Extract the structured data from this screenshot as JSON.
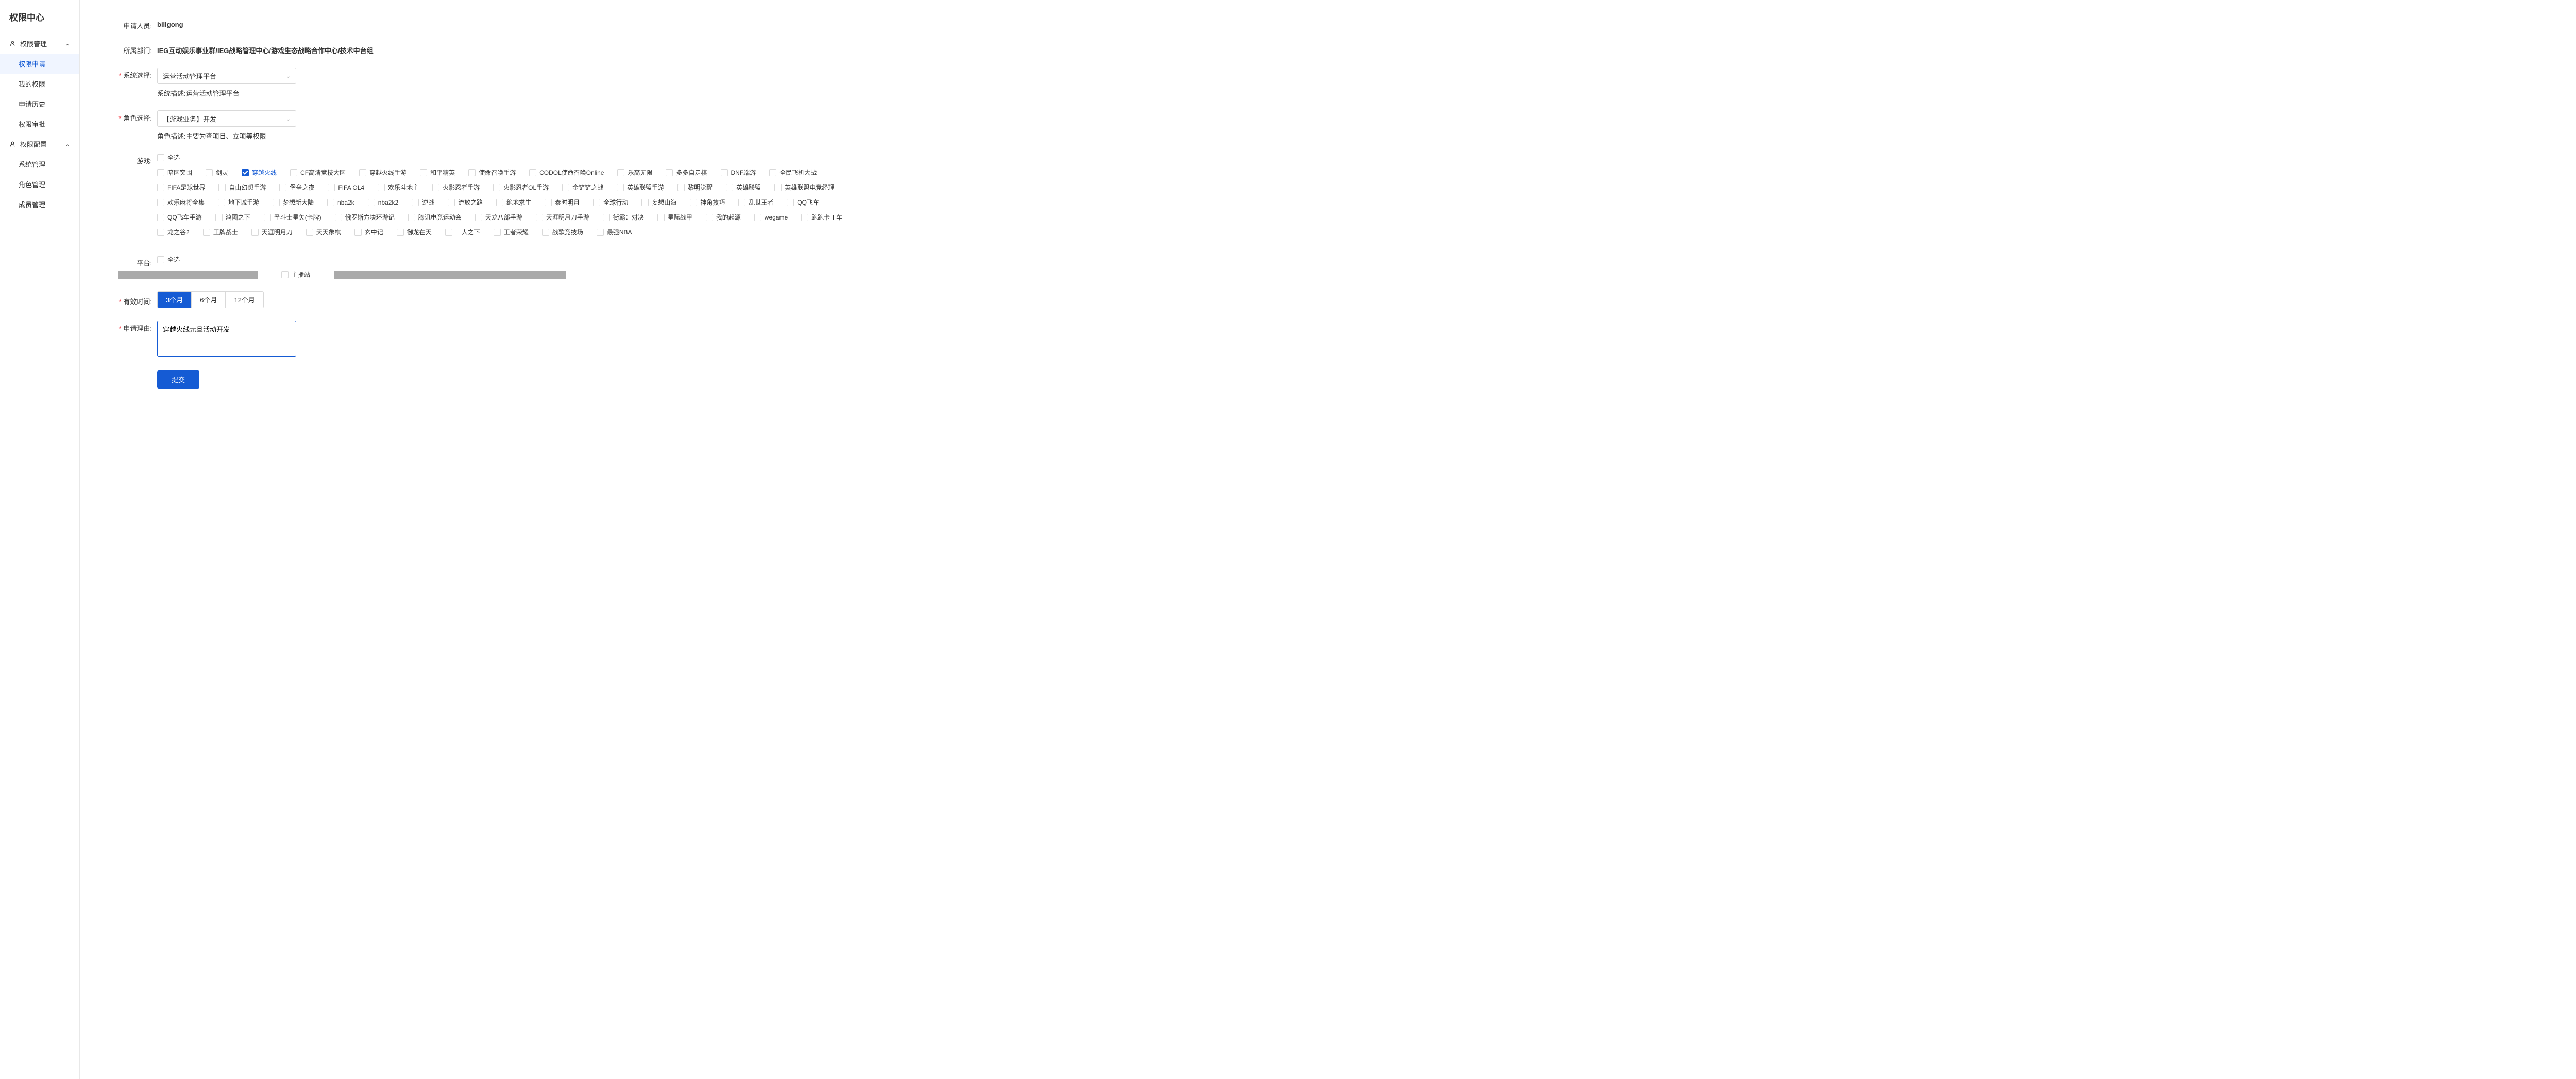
{
  "sidebar": {
    "title": "权限中心",
    "groups": [
      {
        "label": "权限管理",
        "expanded": true,
        "items": [
          {
            "label": "权限申请",
            "active": true
          },
          {
            "label": "我的权限",
            "active": false
          },
          {
            "label": "申请历史",
            "active": false
          },
          {
            "label": "权限审批",
            "active": false
          }
        ]
      },
      {
        "label": "权限配置",
        "expanded": true,
        "items": [
          {
            "label": "系统管理",
            "active": false
          },
          {
            "label": "角色管理",
            "active": false
          },
          {
            "label": "成员管理",
            "active": false
          }
        ]
      }
    ]
  },
  "form": {
    "applicant": {
      "label": "申请人员:",
      "value": "billgong"
    },
    "department": {
      "label": "所属部门:",
      "value": "IEG互动娱乐事业群/IEG战略管理中心/游戏生态战略合作中心/技术中台组"
    },
    "system": {
      "label": "系统选择:",
      "value": "运营活动管理平台",
      "desc": "系统描述:运营活动管理平台"
    },
    "role": {
      "label": "角色选择:",
      "value": "【游戏业务】开发",
      "desc": "角色描述:主要为查项目、立项等权限"
    },
    "games": {
      "label": "游戏:",
      "selectAll": "全选",
      "items": [
        {
          "label": "暗区突围",
          "checked": false
        },
        {
          "label": "剑灵",
          "checked": false
        },
        {
          "label": "穿越火线",
          "checked": true
        },
        {
          "label": "CF高清竞技大区",
          "checked": false
        },
        {
          "label": "穿越火线手游",
          "checked": false
        },
        {
          "label": "和平精英",
          "checked": false
        },
        {
          "label": "使命召唤手游",
          "checked": false
        },
        {
          "label": "CODOL使命召唤Online",
          "checked": false
        },
        {
          "label": "乐高无限",
          "checked": false
        },
        {
          "label": "多多自走棋",
          "checked": false
        },
        {
          "label": "DNF端游",
          "checked": false
        },
        {
          "label": "全民飞机大战",
          "checked": false
        },
        {
          "label": "FIFA足球世界",
          "checked": false
        },
        {
          "label": "自由幻想手游",
          "checked": false
        },
        {
          "label": "堡垒之夜",
          "checked": false
        },
        {
          "label": "FIFA OL4",
          "checked": false
        },
        {
          "label": "欢乐斗地主",
          "checked": false
        },
        {
          "label": "火影忍者手游",
          "checked": false
        },
        {
          "label": "火影忍者OL手游",
          "checked": false
        },
        {
          "label": "金铲铲之战",
          "checked": false
        },
        {
          "label": "英雄联盟手游",
          "checked": false
        },
        {
          "label": "黎明觉醒",
          "checked": false
        },
        {
          "label": "英雄联盟",
          "checked": false
        },
        {
          "label": "英雄联盟电竞经理",
          "checked": false
        },
        {
          "label": "欢乐麻将全集",
          "checked": false
        },
        {
          "label": "地下城手游",
          "checked": false
        },
        {
          "label": "梦想新大陆",
          "checked": false
        },
        {
          "label": "nba2k",
          "checked": false
        },
        {
          "label": "nba2k2",
          "checked": false
        },
        {
          "label": "逆战",
          "checked": false
        },
        {
          "label": "流放之路",
          "checked": false
        },
        {
          "label": "绝地求生",
          "checked": false
        },
        {
          "label": "秦时明月",
          "checked": false
        },
        {
          "label": "全球行动",
          "checked": false
        },
        {
          "label": "妄想山海",
          "checked": false
        },
        {
          "label": "神角技巧",
          "checked": false
        },
        {
          "label": "乱世王者",
          "checked": false
        },
        {
          "label": "QQ飞车",
          "checked": false
        },
        {
          "label": "QQ飞车手游",
          "checked": false
        },
        {
          "label": "鸿图之下",
          "checked": false
        },
        {
          "label": "圣斗士星矢(卡牌)",
          "checked": false
        },
        {
          "label": "俄罗斯方块环游记",
          "checked": false
        },
        {
          "label": "腾讯电竞运动会",
          "checked": false
        },
        {
          "label": "天龙八部手游",
          "checked": false
        },
        {
          "label": "天涯明月刀手游",
          "checked": false
        },
        {
          "label": "街霸：对决",
          "checked": false
        },
        {
          "label": "星际战甲",
          "checked": false
        },
        {
          "label": "我的起源",
          "checked": false
        },
        {
          "label": "wegame",
          "checked": false
        },
        {
          "label": "跑跑卡丁车",
          "checked": false
        },
        {
          "label": "龙之谷2",
          "checked": false
        },
        {
          "label": "王牌战士",
          "checked": false
        },
        {
          "label": "天涯明月刀",
          "checked": false
        },
        {
          "label": "天天象棋",
          "checked": false
        },
        {
          "label": "玄中记",
          "checked": false
        },
        {
          "label": "御龙在天",
          "checked": false
        },
        {
          "label": "一人之下",
          "checked": false
        },
        {
          "label": "王者荣耀",
          "checked": false
        },
        {
          "label": "战歌竞技场",
          "checked": false
        },
        {
          "label": "最强NBA",
          "checked": false
        }
      ]
    },
    "platform": {
      "label": "平台:",
      "selectAll": "全选",
      "hostLabel": "主播站"
    },
    "validity": {
      "label": "有效时间:",
      "options": [
        {
          "label": "3个月",
          "active": true
        },
        {
          "label": "6个月",
          "active": false
        },
        {
          "label": "12个月",
          "active": false
        }
      ]
    },
    "reason": {
      "label": "申请理由:",
      "value": "穿越火线元旦活动开发"
    },
    "submit": "提交"
  }
}
